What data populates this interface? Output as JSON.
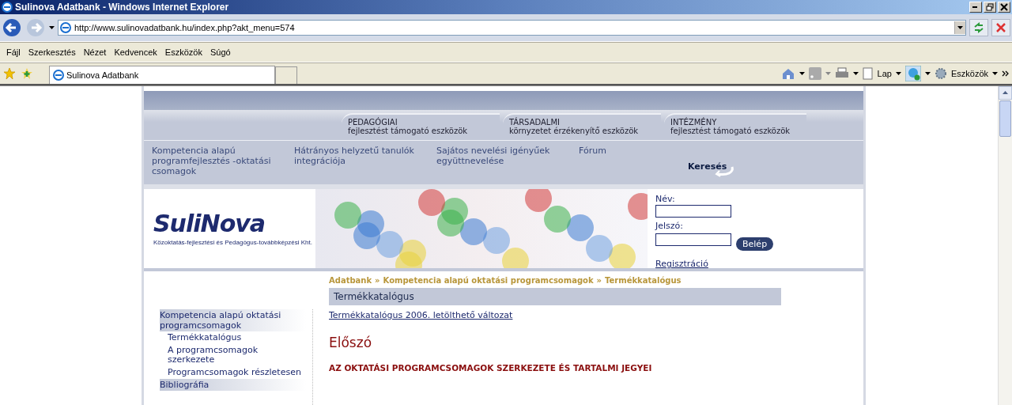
{
  "window": {
    "title": "Sulinova Adatbank - Windows Internet Explorer"
  },
  "address": {
    "url": "http://www.sulinovadatbank.hu/index.php?akt_menu=574"
  },
  "menu": [
    "Fájl",
    "Szerkesztés",
    "Nézet",
    "Kedvencek",
    "Eszközök",
    "Súgó"
  ],
  "tabs": [
    {
      "label": "Sulinova Adatbank",
      "selected": true
    }
  ],
  "command_bar": {
    "page_label": "Lap",
    "tools_label": "Eszközök"
  },
  "site": {
    "top_tabs": [
      {
        "title": "PEDAGÓGIAI",
        "subtitle": "fejlesztést támogató eszközök"
      },
      {
        "title": "TÁRSADALMI",
        "subtitle": "környzetet érzékenyítő eszközök"
      },
      {
        "title": "INTÉZMÉNY",
        "subtitle": "fejlesztést támogató eszközök"
      }
    ],
    "nav": [
      "Kompetencia alapú programfejlesztés -oktatási csomagok",
      "Hátrányos helyzetű tanulók integrációja",
      "Sajátos nevelési igényűek együttnevelése",
      "Fórum"
    ],
    "search_label": "Keresés",
    "logo": {
      "name": "SuliNova",
      "tagline": "Közoktatás-fejlesztési és Pedagógus-továbbképzési Kht."
    },
    "login": {
      "name_label": "Név:",
      "password_label": "Jelszó:",
      "button": "Belép",
      "register": "Regisztráció"
    },
    "breadcrumb": {
      "separator": "»",
      "items": [
        "Adatbank",
        "Kompetencia alapú oktatási programcsomagok",
        "Termékkatalógus"
      ]
    },
    "sidebar": [
      {
        "label": "Kompetencia alapú oktatási programcsomagok",
        "children": [
          {
            "label": "Termékkatalógus"
          },
          {
            "label": "A programcsomagok szerkezete"
          },
          {
            "label": "Programcsomagok részletesen"
          }
        ]
      },
      {
        "label": "Bibliográfia"
      }
    ],
    "content": {
      "title": "Termékkatalógus",
      "link": "Termékkatalógus 2006. letölthető változat",
      "heading": "Előszó",
      "subheading": "AZ OKTATÁSI PROGRAMCSOMAGOK SZERKEZETE ÉS TARTALMI JEGYEI"
    }
  }
}
